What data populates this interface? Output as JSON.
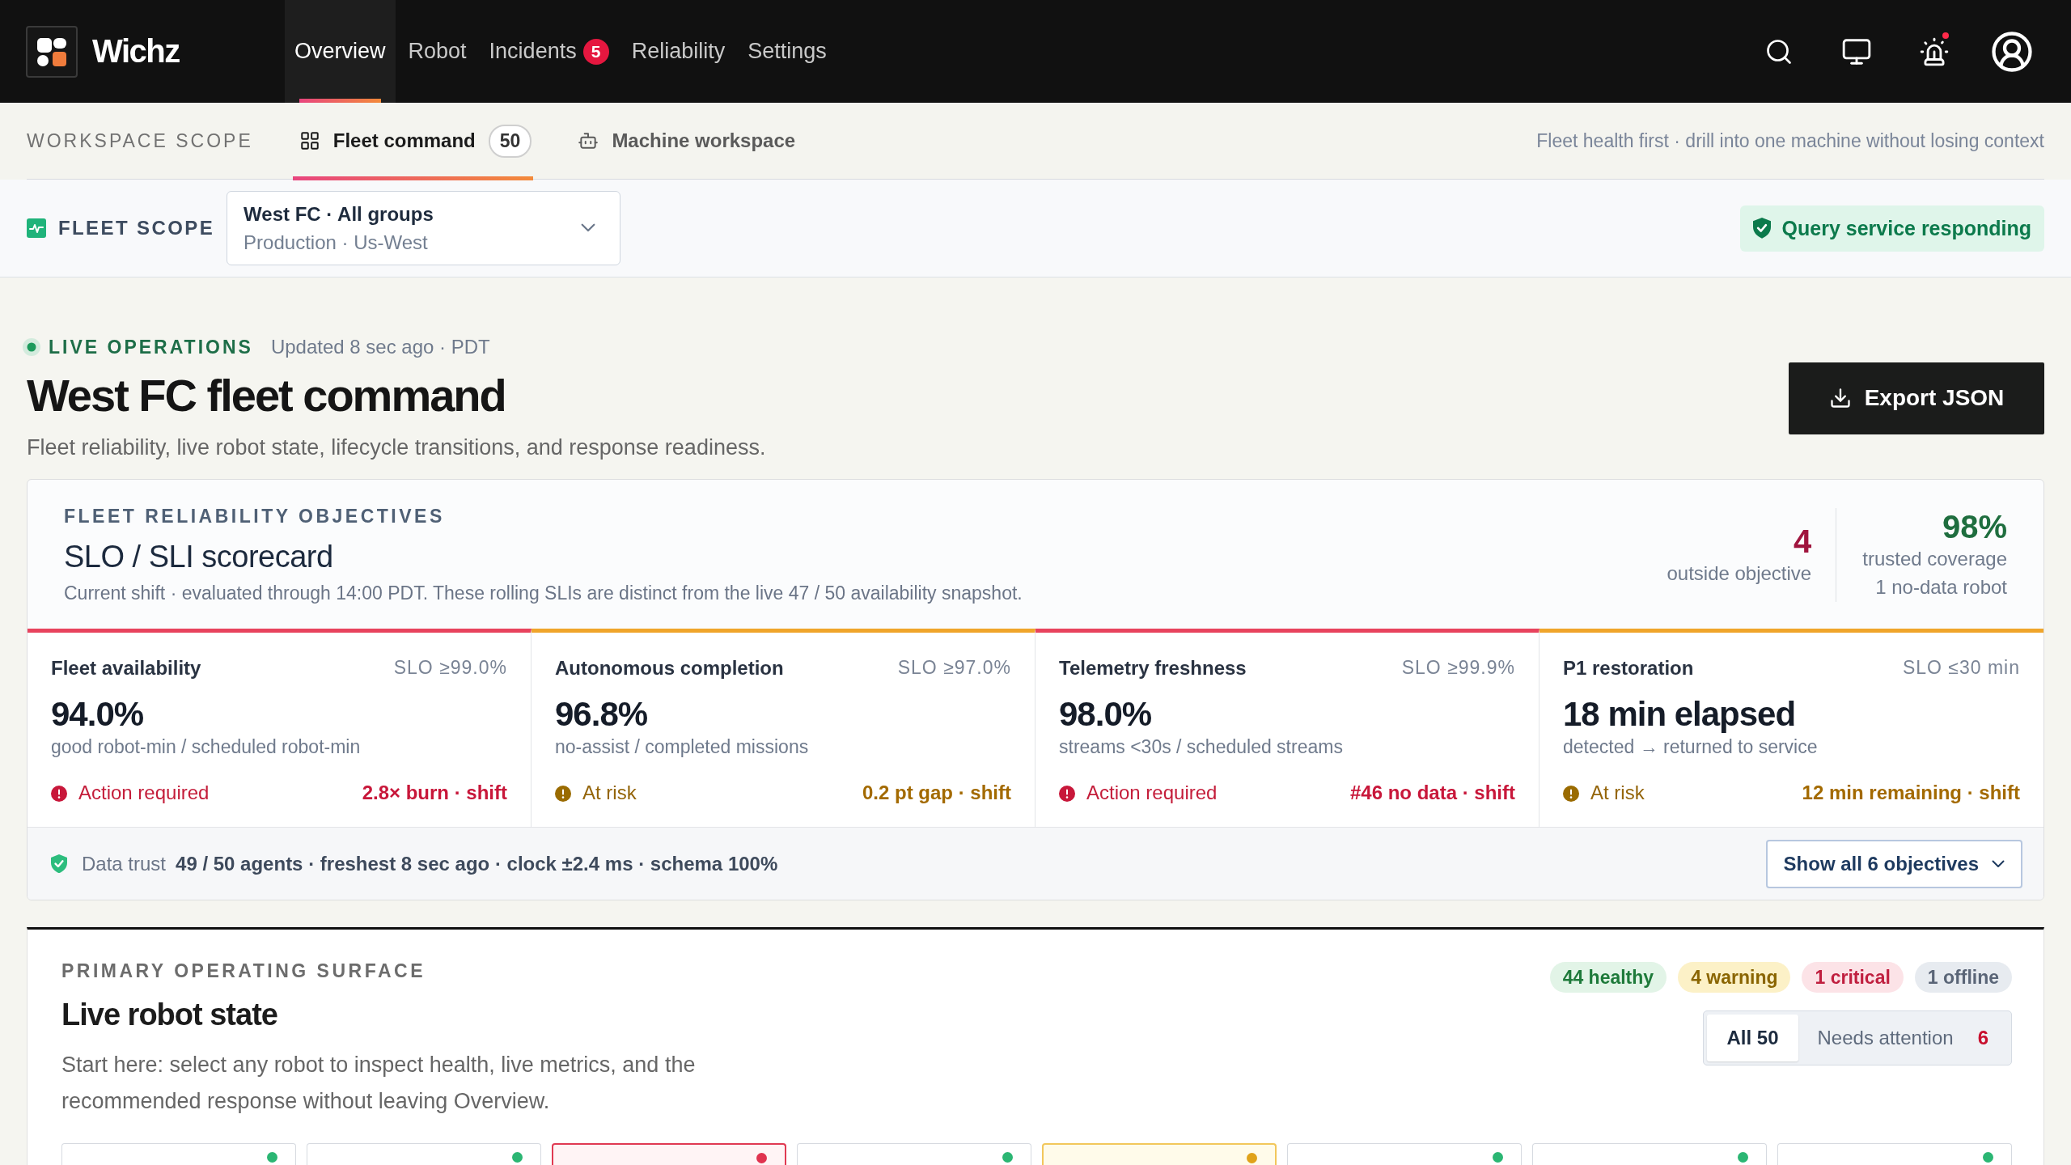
{
  "nav": {
    "brand": "Wichz",
    "items": [
      {
        "label": "Overview",
        "selected": true
      },
      {
        "label": "Robot",
        "selected": false
      },
      {
        "label": "Incidents",
        "selected": false,
        "badge": "5"
      },
      {
        "label": "Reliability",
        "selected": false
      },
      {
        "label": "Settings",
        "selected": false
      }
    ],
    "alerts_unread": true
  },
  "workspace": {
    "label": "WORKSPACE SCOPE",
    "tabs": [
      {
        "kind": "fleet",
        "label": "Fleet command",
        "count": "50",
        "selected": true
      },
      {
        "kind": "machine",
        "label": "Machine workspace",
        "selected": false
      }
    ],
    "hint": "Fleet health first · drill into one machine without losing context"
  },
  "fleet_scope": {
    "label": "FLEET SCOPE",
    "select": {
      "value": "West FC · All groups",
      "detail": "Production · Us-West"
    },
    "status": "Query service responding"
  },
  "header": {
    "live_label": "LIVE OPERATIONS",
    "updated": "Updated 8 sec ago · PDT",
    "title": "West FC fleet command",
    "subtitle": "Fleet reliability, live robot state, lifecycle transitions, and response readiness.",
    "export_button": "Export JSON"
  },
  "scorecard": {
    "eyebrow": "FLEET RELIABILITY OBJECTIVES",
    "title": "SLO / SLI scorecard",
    "description": "Current shift · evaluated through 14:00 PDT. These rolling SLIs are distinct from the live 47 / 50 availability snapshot.",
    "summary": [
      {
        "kind": "bad",
        "value": "4",
        "label": "outside objective"
      },
      {
        "kind": "good",
        "value": "98%",
        "label": "trusted coverage",
        "note": "1 no-data robot"
      }
    ],
    "objectives": [
      {
        "kind": "critical",
        "name": "Fleet availability",
        "target": "SLO ≥99.0%",
        "value": "94.0%",
        "definition": "good robot-min / scheduled robot-min",
        "status": "Action required",
        "detail": "2.8× burn · shift"
      },
      {
        "kind": "warning",
        "name": "Autonomous completion",
        "target": "SLO ≥97.0%",
        "value": "96.8%",
        "definition": "no-assist / completed missions",
        "status": "At risk",
        "detail": "0.2 pt gap · shift"
      },
      {
        "kind": "critical",
        "name": "Telemetry freshness",
        "target": "SLO ≥99.9%",
        "value": "98.0%",
        "definition": "streams <30s / scheduled streams",
        "status": "Action required",
        "detail": "#46 no data · shift"
      },
      {
        "kind": "warning",
        "name": "P1 restoration",
        "target": "SLO ≤30 min",
        "value": "18 min elapsed",
        "definition": "detected → returned to service",
        "status": "At risk",
        "detail": "12 min remaining · shift"
      }
    ],
    "data_trust": {
      "label": "Data trust",
      "text": "49 / 50 agents · freshest 8 sec ago · clock ±2.4 ms · schema 100%"
    },
    "show_all_button": "Show all 6 objectives"
  },
  "live_state": {
    "eyebrow": "PRIMARY OPERATING SURFACE",
    "title": "Live robot state",
    "description": "Start here: select any robot to inspect health, live metrics, and the recommended response without leaving Overview.",
    "counts": [
      {
        "kind": "healthy",
        "label": "44 healthy"
      },
      {
        "kind": "warning",
        "label": "4 warning"
      },
      {
        "kind": "critical",
        "label": "1 critical"
      },
      {
        "kind": "offline",
        "label": "1 offline"
      }
    ],
    "filters": [
      {
        "label": "All 50",
        "selected": true
      },
      {
        "label": "Needs attention",
        "count": "6",
        "selected": false
      }
    ],
    "robots": [
      {
        "kind": "healthy"
      },
      {
        "kind": "healthy"
      },
      {
        "kind": "critical"
      },
      {
        "kind": "healthy"
      },
      {
        "kind": "warning"
      },
      {
        "kind": "healthy"
      },
      {
        "kind": "healthy"
      },
      {
        "kind": "healthy"
      }
    ]
  }
}
